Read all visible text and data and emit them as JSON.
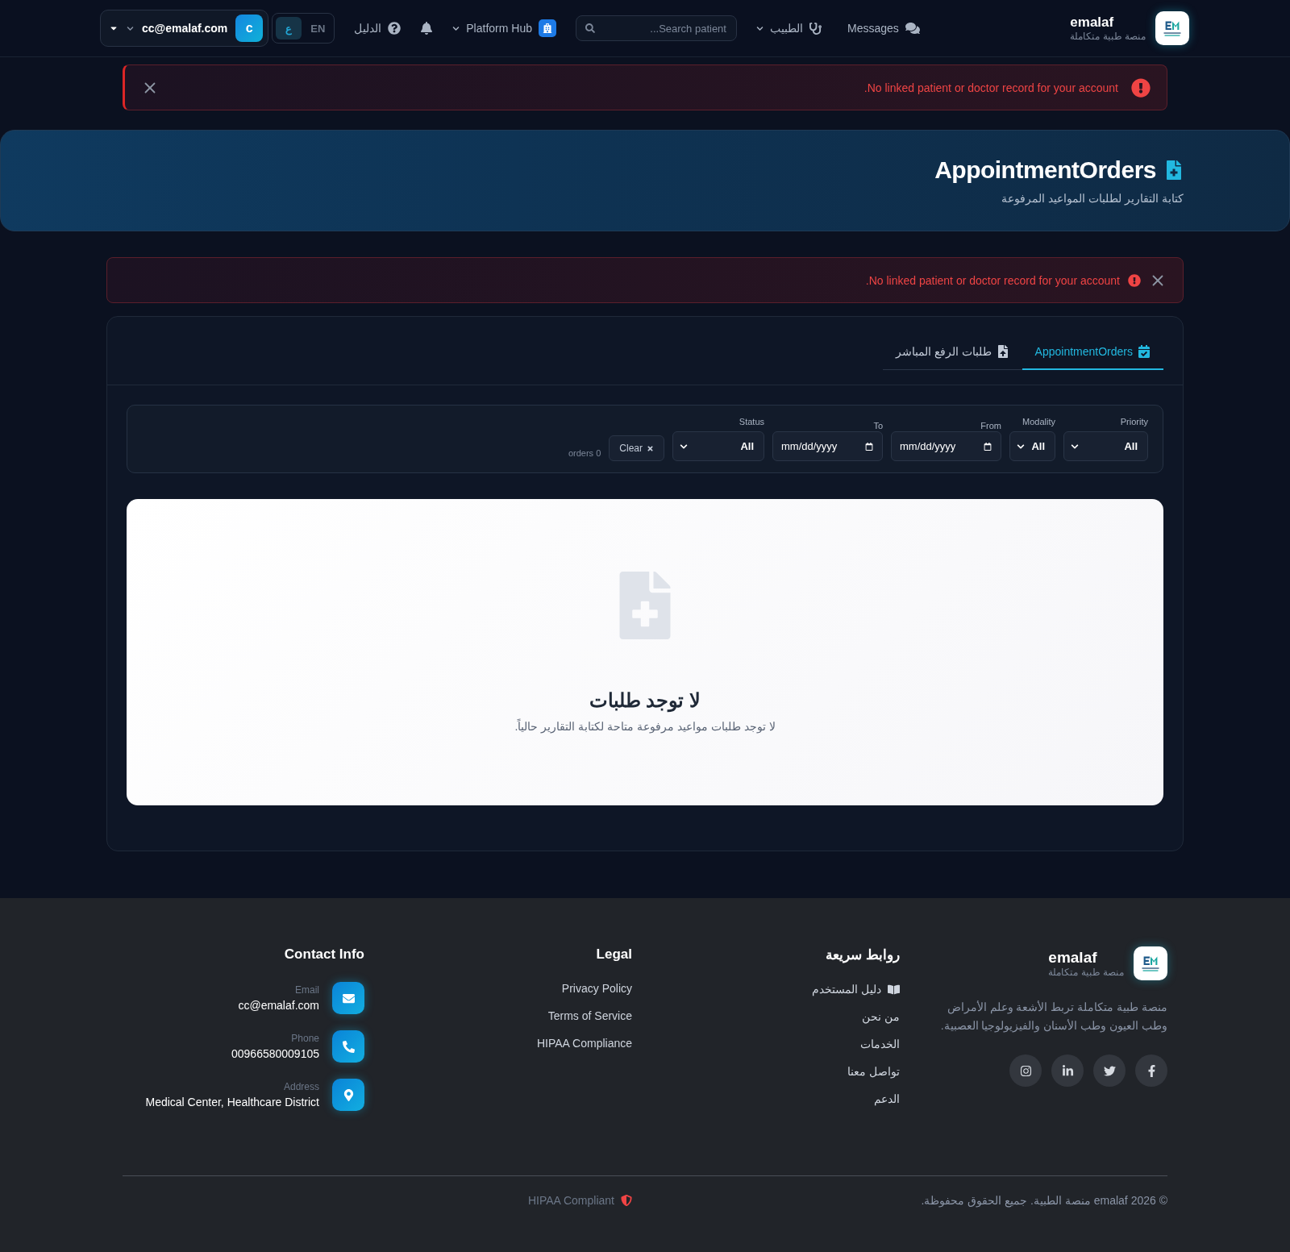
{
  "header": {
    "brand": {
      "name": "emalaf",
      "tagline": "منصة طبية متكاملة"
    },
    "messages": "Messages",
    "doctor_menu": "الطبيب",
    "search": {
      "placeholder": "Search patient..."
    },
    "platform_hub": "Platform Hub",
    "guide": "الدليل",
    "languages": [
      {
        "label": "EN",
        "selected": false
      },
      {
        "label": "ع",
        "selected": true
      }
    ],
    "user": {
      "initial": "c",
      "email": "cc@emalaf.com"
    }
  },
  "top_alert": {
    "message": "No linked patient or doctor record for your account."
  },
  "hero": {
    "title": "AppointmentOrders",
    "subtitle": "كتابة التقارير لطلبات المواعيد المرفوعة"
  },
  "page_alert": {
    "message": "No linked patient or doctor record for your account."
  },
  "tabs": [
    {
      "label": "AppointmentOrders",
      "selected": true
    },
    {
      "label": "طلبات الرفع المباشر",
      "selected": false
    }
  ],
  "filters": [
    {
      "kind": "select",
      "label": "Priority",
      "value": "All"
    },
    {
      "kind": "select",
      "label": "Modality",
      "value": "All"
    },
    {
      "kind": "date",
      "label": "From",
      "placeholder": "mm/dd/yyyy"
    },
    {
      "kind": "date",
      "label": "To",
      "placeholder": "mm/dd/yyyy"
    },
    {
      "kind": "select",
      "label": "Status",
      "value": "All"
    }
  ],
  "clear_button": "Clear",
  "order_count": "0 orders",
  "empty_state": {
    "title": "لا توجد طلبات",
    "message": "لا توجد طلبات مواعيد مرفوعة متاحة لكتابة التقارير حالياً."
  },
  "footer": {
    "brand": {
      "name": "emalaf",
      "tagline": "منصة طبية متكاملة",
      "description": "منصة طبية متكاملة تربط الأشعة وعلم الأمراض وطب العيون وطب الأسنان والفيزيولوجيا العصبية."
    },
    "socials": [
      {
        "kind": "facebook"
      },
      {
        "kind": "twitter"
      },
      {
        "kind": "linkedin"
      },
      {
        "kind": "instagram"
      }
    ],
    "quick_links": {
      "title": "روابط سريعة",
      "items": [
        {
          "label": "دليل المستخدم",
          "kind": "guide"
        },
        {
          "label": "من نحن"
        },
        {
          "label": "الخدمات"
        },
        {
          "label": "تواصل معنا"
        },
        {
          "label": "الدعم"
        }
      ]
    },
    "legal": {
      "title": "Legal",
      "items": [
        "Privacy Policy",
        "Terms of Service",
        "HIPAA Compliance"
      ]
    },
    "contact": {
      "title": "Contact Info",
      "items": [
        {
          "kind": "email",
          "label": "Email",
          "value": "cc@emalaf.com"
        },
        {
          "kind": "phone",
          "label": "Phone",
          "value": "00966580009105"
        },
        {
          "kind": "address",
          "label": "Address",
          "value": "Medical Center, Healthcare District"
        }
      ]
    },
    "copyright": "© 2026 emalaf منصة الطبية. جميع الحقوق محفوظة.",
    "compliance": "HIPAA Compliant"
  }
}
